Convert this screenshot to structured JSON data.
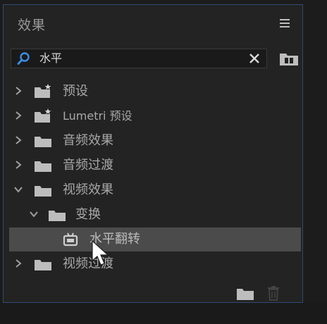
{
  "panel": {
    "title": "效果"
  },
  "search": {
    "value": "水平"
  },
  "tree": {
    "items": [
      {
        "label": "预设",
        "depth": 0,
        "expanded": false
      },
      {
        "label": "Lumetri 预设",
        "depth": 0,
        "expanded": false
      },
      {
        "label": "音频效果",
        "depth": 0,
        "expanded": false
      },
      {
        "label": "音频过渡",
        "depth": 0,
        "expanded": false
      },
      {
        "label": "视频效果",
        "depth": 0,
        "expanded": true
      },
      {
        "label": "变换",
        "depth": 1,
        "expanded": true
      },
      {
        "label": "水平翻转",
        "depth": 2,
        "selected": true
      },
      {
        "label": "视频过渡",
        "depth": 0,
        "expanded": false
      }
    ]
  },
  "icons": {
    "menu": "hamburger-icon",
    "search": "search-icon",
    "clear": "close-icon",
    "new_bin": "new-custom-bin-icon",
    "folder": "folder-icon",
    "preset_folder": "preset-folder-icon",
    "effect": "effect-icon",
    "new_folder": "new-folder-icon",
    "delete": "trash-icon"
  },
  "colors": {
    "panel_bg": "#232323",
    "border_accent": "#2f4a73",
    "search_accent": "#3b8ee6",
    "selected_row": "#4b4b4b",
    "text": "#a8a8a8"
  }
}
